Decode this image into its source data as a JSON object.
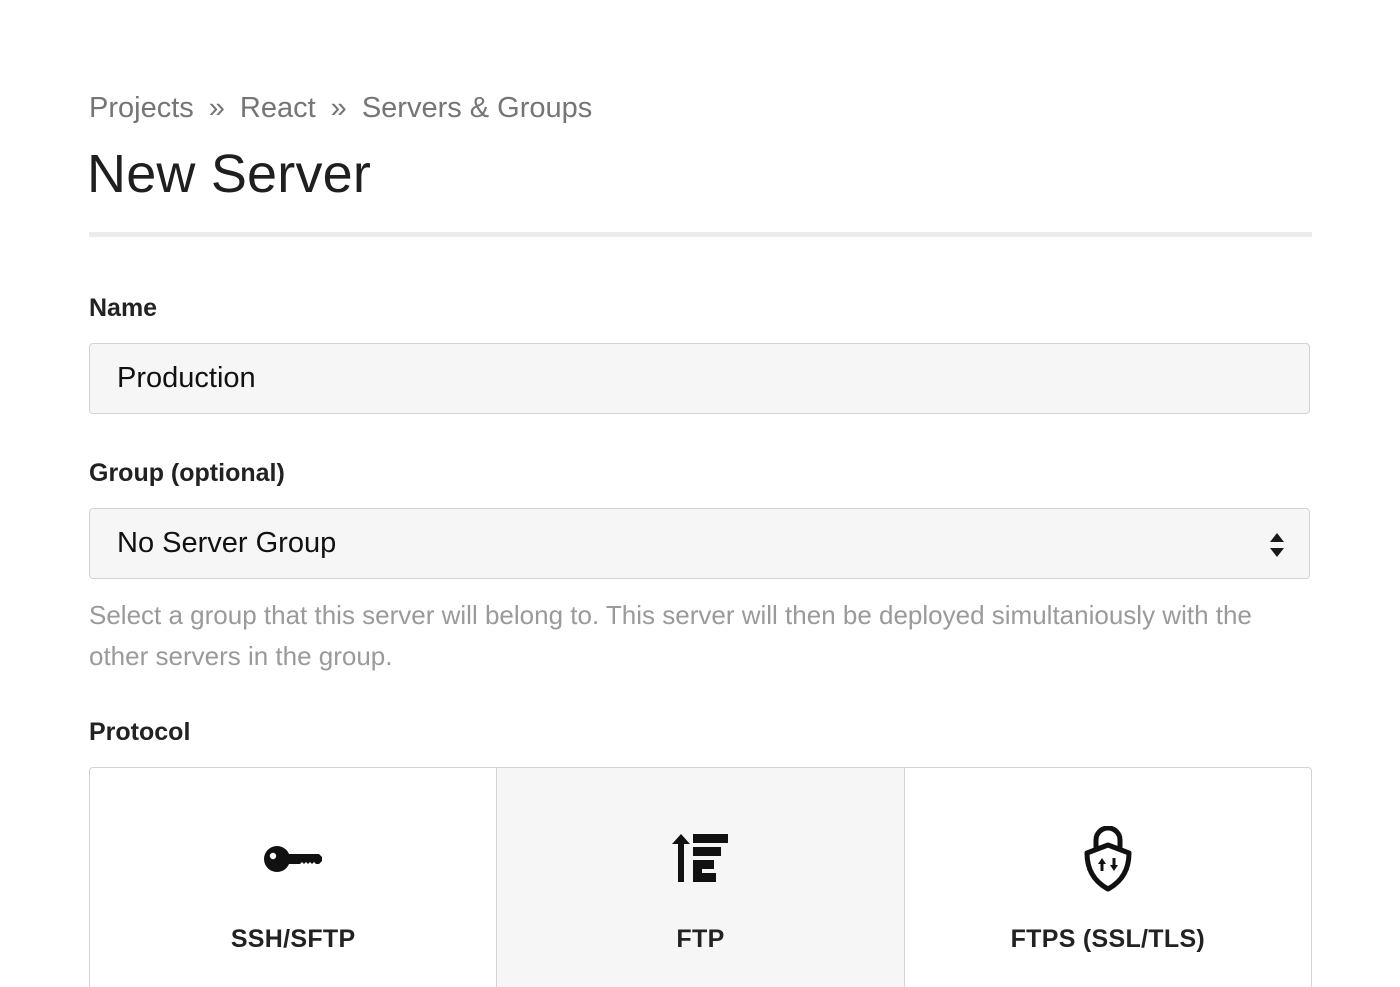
{
  "breadcrumb": {
    "items": [
      "Projects",
      "React",
      "Servers & Groups"
    ],
    "separator": "»"
  },
  "page_title": "New Server",
  "form": {
    "name": {
      "label": "Name",
      "value": "Production"
    },
    "group": {
      "label": "Group (optional)",
      "selected": "No Server Group",
      "help": "Select a group that this server will belong to. This server will then be deployed simultaniously with the other servers in the group."
    },
    "protocol": {
      "label": "Protocol",
      "options": [
        {
          "label": "SSH/SFTP",
          "icon": "key-icon",
          "selected": false
        },
        {
          "label": "FTP",
          "icon": "ftp-upload-icon",
          "selected": true
        },
        {
          "label": "FTPS (SSL/TLS)",
          "icon": "shield-lock-icon",
          "selected": false
        }
      ]
    }
  },
  "colors": {
    "text": "#1f1f1f",
    "muted": "#757575",
    "help": "#9a9a9a",
    "field_bg": "#f6f6f6",
    "border": "#d3d3d3",
    "divider": "#ebebeb"
  }
}
